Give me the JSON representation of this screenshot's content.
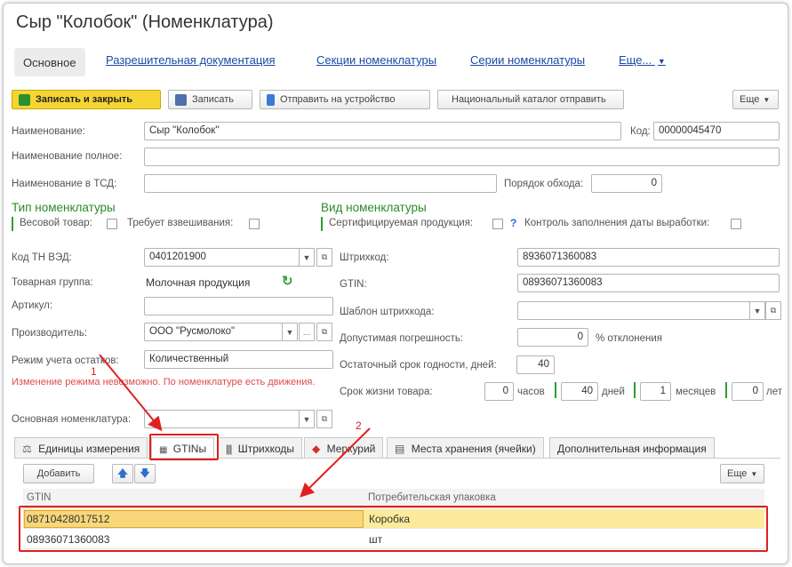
{
  "window": {
    "title": "Сыр \"Колобок\" (Номенклатура)"
  },
  "nav": {
    "active": "Основное",
    "links": [
      "Разрешительная документация",
      "Секции номенклатуры",
      "Серии номенклатуры",
      "Еще..."
    ]
  },
  "toolbar": {
    "save_close": "Записать и закрыть",
    "save": "Записать",
    "send_device": "Отправить на устройство",
    "national_catalog": "Национальный каталог отправить",
    "more": "Еще"
  },
  "form": {
    "name_label": "Наименование:",
    "name_value": "Сыр \"Колобок\"",
    "code_label": "Код:",
    "code_value": "00000045470",
    "fullname_label": "Наименование полное:",
    "tsd_label": "Наименование в ТСД:",
    "order_label": "Порядок обхода:",
    "order_value": "0"
  },
  "type_section": {
    "title": "Тип номенклатуры",
    "weight_label": "Весовой товар:",
    "weighing_label": "Требует взвешивания:"
  },
  "kind_section": {
    "title": "Вид номенклатуры",
    "certified_label": "Сертифицируемая продукция:",
    "help": "?",
    "date_control_label": "Контроль заполнения даты выработки:"
  },
  "left_fields": {
    "tnved_label": "Код ТН ВЭД:",
    "tnved_value": "0401201900",
    "group_label": "Товарная группа:",
    "group_value": "Молочная продукция",
    "article_label": "Артикул:",
    "producer_label": "Производитель:",
    "producer_value": "ООО \"Русмолоко\"",
    "stock_mode_label": "Режим учета остатков:",
    "stock_mode_value": "Количественный",
    "warning": "Изменение режима невозможно. По номенклатуре есть движения.",
    "base_label": "Основная номенклатура:"
  },
  "right_fields": {
    "barcode_label": "Штрихкод:",
    "barcode_value": "8936071360083",
    "gtin_label": "GTIN:",
    "gtin_value": "08936071360083",
    "template_label": "Шаблон штрихкода:",
    "tolerance_label": "Допустимая погрешность:",
    "tolerance_value": "0",
    "tolerance_unit": "% отклонения",
    "shelf_label": "Остаточный срок годности, дней:",
    "shelf_value": "40",
    "life_label": "Срок жизни товара:",
    "hours_value": "0",
    "hours_unit": "часов",
    "days_value": "40",
    "days_unit": "дней",
    "months_value": "1",
    "months_unit": "месяцев",
    "years_value": "0",
    "years_unit": "лет"
  },
  "tabs": [
    "Единицы измерения",
    "GTINы",
    "Штрихкоды",
    "Меркурий",
    "Места хранения (ячейки)",
    "Дополнительная информация"
  ],
  "grid": {
    "add": "Добавить",
    "more": "Еще",
    "columns": [
      "GTIN",
      "Потребительская упаковка"
    ],
    "rows": [
      {
        "gtin": "08710428017512",
        "pack": "Коробка"
      },
      {
        "gtin": "08936071360083",
        "pack": "шт"
      }
    ]
  },
  "annotations": {
    "first": "1",
    "second": "2"
  },
  "colors": {
    "accent": "#f5d533",
    "link": "#1a4aa6",
    "section": "#2a8a2a",
    "highlight": "#e02020",
    "selected_row": "#fbeb9b"
  }
}
